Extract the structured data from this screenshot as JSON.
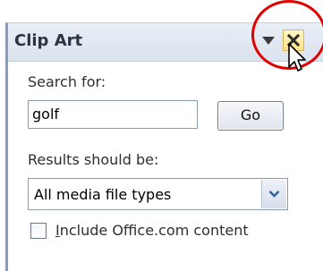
{
  "pane": {
    "title": "Clip Art"
  },
  "search": {
    "label": "Search for:",
    "value": "golf",
    "go_label": "Go"
  },
  "results": {
    "label": "Results should be:",
    "selected": "All media file types"
  },
  "include_office": {
    "mnemonic": "I",
    "label_rest": "nclude Office.com content",
    "checked": false
  },
  "icons": {
    "menu": "chevron-down-icon",
    "close": "close-icon",
    "dropdown": "chevron-down-icon",
    "cursor": "mouse-cursor-icon"
  },
  "colors": {
    "title_text": "#2a3543",
    "close_hover": "#ffe28a",
    "highlight_circle": "#e00000"
  }
}
